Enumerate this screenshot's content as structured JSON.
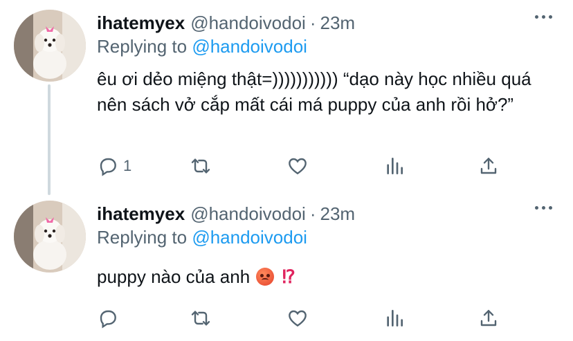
{
  "tweets": [
    {
      "display_name": "ihatemyex",
      "handle": "@handoivodoi",
      "separator": "·",
      "time": "23m",
      "replying_prefix": "Replying to",
      "replying_to": "@handoivodoi",
      "text": "êu ơi dẻo miệng thật=)))))))))))  “dạo này học nhiều quá nên sách vở cắp mất cái má puppy của anh rồi hở?”",
      "reply_count": "1"
    },
    {
      "display_name": "ihatemyex",
      "handle": "@handoivodoi",
      "separator": "·",
      "time": "23m",
      "replying_prefix": "Replying to",
      "replying_to": "@handoivodoi",
      "text": "puppy nào của anh",
      "emoji_excl": "⁉"
    }
  ],
  "icons": {
    "reply": "reply-icon",
    "retweet": "retweet-icon",
    "like": "heart-icon",
    "stats": "analytics-icon",
    "share": "share-icon",
    "more": "more-icon"
  },
  "colors": {
    "accent": "#1d9bf0",
    "secondary_text": "#536471",
    "thread_line": "#cfd9de"
  }
}
